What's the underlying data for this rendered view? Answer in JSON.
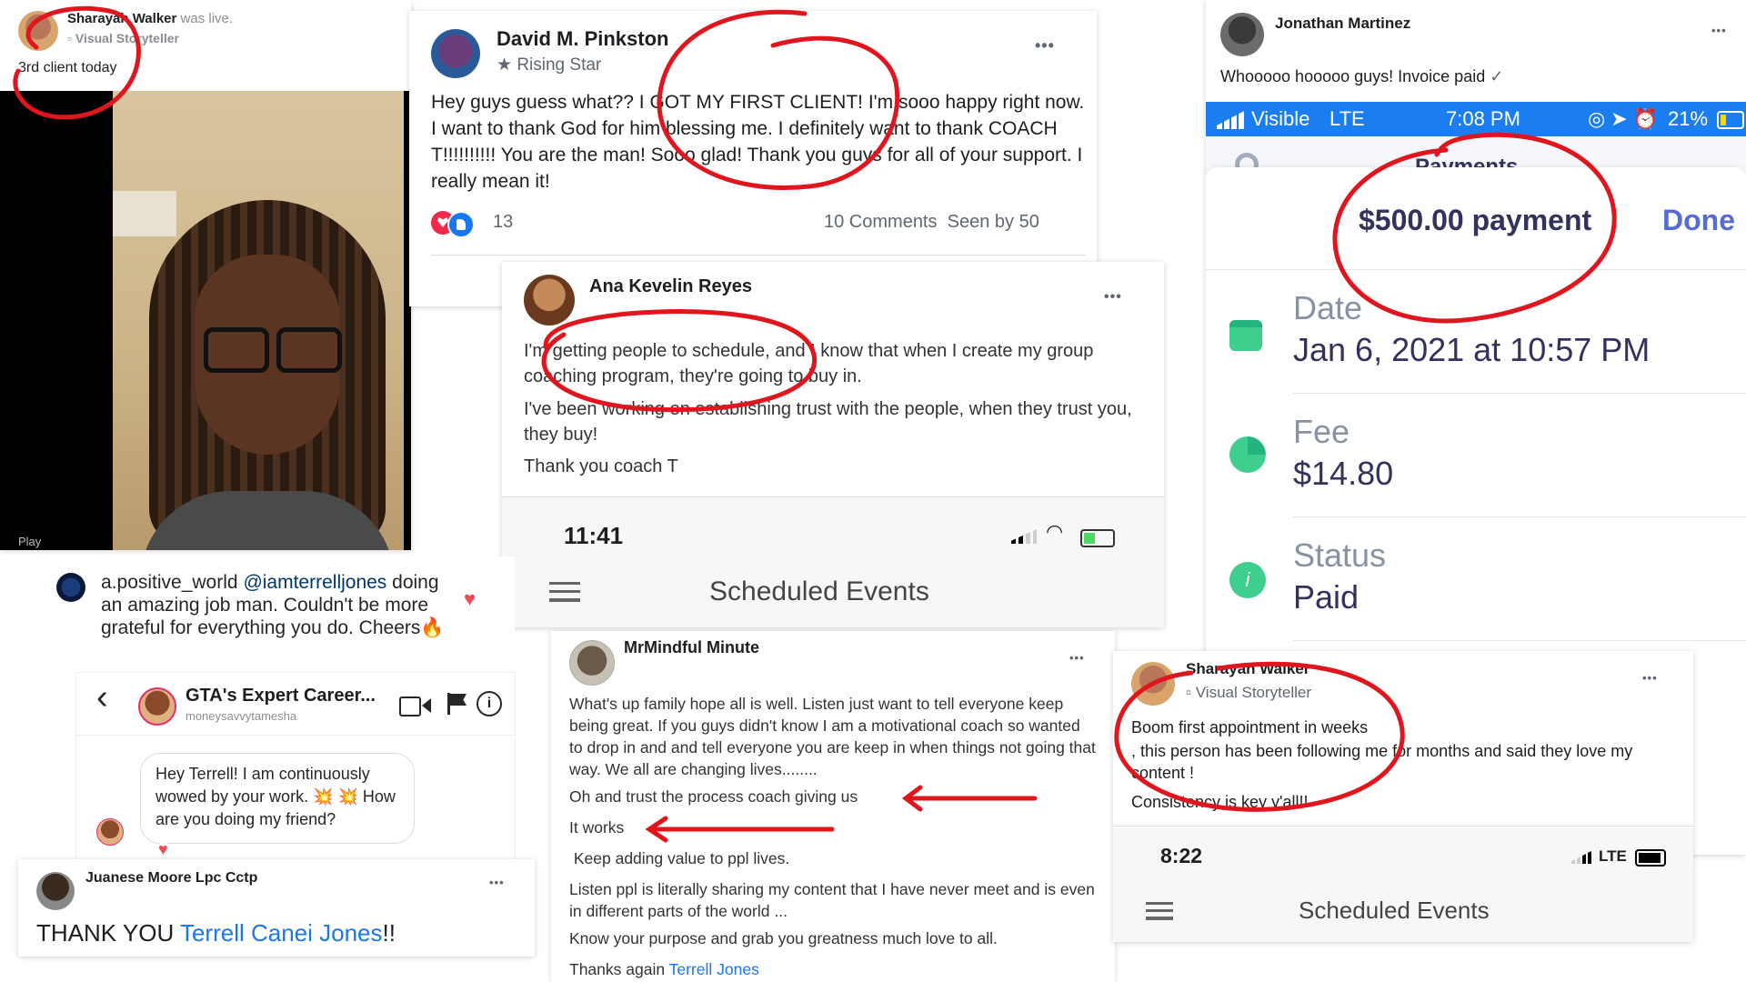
{
  "live_card": {
    "author": "Sharayah Walker",
    "action": "was live.",
    "badge": "Visual Storyteller",
    "caption": "3rd client today",
    "play_label": "Play"
  },
  "david_post": {
    "author": "David M. Pinkston",
    "badge": "Rising Star",
    "body": "Hey guys guess what?? I GOT MY FIRST CLIENT! I'm sooo happy right now. I want to thank God for him blessing me. I definitely want to thank COACH T!!!!!!!!!! You are the man! Sooo glad! Thank you guys for all of your support. I really mean it!",
    "reaction_count": "13",
    "comments": "10 Comments",
    "seen": "Seen by 50"
  },
  "ana_post": {
    "author": "Ana Kevelin Reyes",
    "line1": "I'm getting people to schedule, and I know that when I create my group coaching program, they're going to buy in.",
    "line2": "I've been working on establishing trust with the people, when they trust you, they buy!",
    "line3": "Thank you coach T",
    "time": "11:41",
    "scheduled": "Scheduled Events"
  },
  "jonathan_post": {
    "author": "Jonathan Martinez",
    "body": "Whooooo hooooo guys! Invoice paid",
    "carrier": "Visible",
    "network": "LTE",
    "clock": "7:08 PM",
    "battery": "21%",
    "header_partial": "Payments",
    "payment": "$500.00 payment",
    "done": "Done",
    "date_label": "Date",
    "date_value": "Jan 6, 2021 at 10:57 PM",
    "fee_label": "Fee",
    "fee_value": "$14.80",
    "status_label": "Status",
    "status_value": "Paid"
  },
  "ig_comment": {
    "user": "a.positive_world",
    "mention": "@iamterrelljones",
    "text": "doing an amazing job man. Couldn't be more grateful for everything you do. Cheers🔥"
  },
  "dm": {
    "title": "GTA's Expert Career...",
    "subtitle": "moneysavvytamesha",
    "message": "Hey Terrell! I am continuously wowed by your work. 💥 💥 How are you doing my friend?"
  },
  "juanese": {
    "author": "Juanese Moore Lpc Cctp",
    "thanks": "THANK YOU ",
    "name": "Terrell Canei Jones",
    "end": "!!"
  },
  "mindful": {
    "author": "MrMindful Minute",
    "p1": "What's up family hope all is well.   Listen just want to tell everyone keep being great.  If you guys didn't know I am a motivational coach so wanted to drop in and and tell everyone you are keep in when things not going that way. We all are changing lives........",
    "p2": "Oh and trust the process coach giving us",
    "p3": "It works",
    "p4": " Keep adding value to ppl lives.",
    "p5": "Listen ppl is literally sharing my content that I have never meet and is even in different parts of the world ...",
    "p6": "Know your purpose and grab you greatness much love to all.",
    "p7": "Thanks again ",
    "p7_link": "Terrell Jones"
  },
  "sharayah_post": {
    "author": "Sharayah Walker",
    "badge": "Visual Storyteller",
    "line1": "Boom first appointment in weeks",
    "line2": ", this person has been following me for months and said they love my content !",
    "line3": "Consistency is key y'all!!",
    "time": "8:22",
    "network": "LTE",
    "scheduled": "Scheduled Events"
  },
  "icons": {
    "more": "•••",
    "star": "★",
    "heart": "♥",
    "check": "✓",
    "back": "‹"
  },
  "colors": {
    "annotation_red": "#e0161e",
    "link_blue": "#1877f2",
    "ios_blue": "#007aff",
    "stripe_green": "#3ecf8e",
    "payment_text": "#32325d"
  }
}
